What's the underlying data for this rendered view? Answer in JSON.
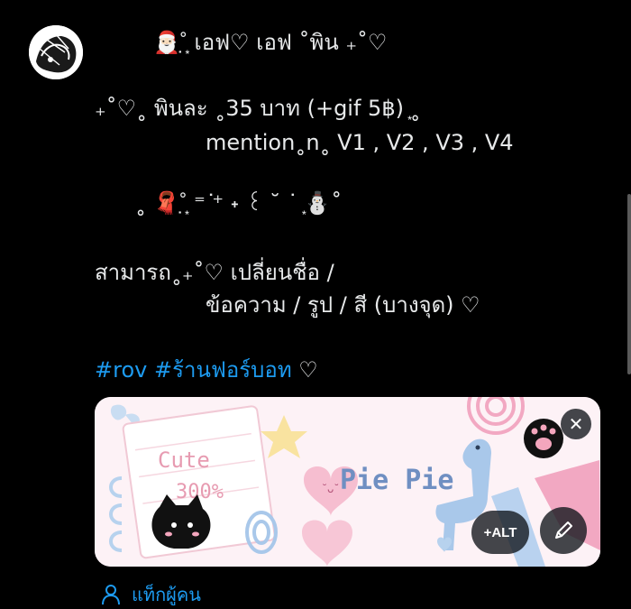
{
  "post": {
    "title_line": "🎅🏻˚̣̣̣͙ เอฟ♡ เอฟ  ˚พิน ₊˚♡",
    "line1": "₊˚♡˳ พินละ ˳35 บาท (+gif 5฿)  ͙˳",
    "line2": "mention˳n˳ V1 , V2 , V3 , V4",
    "line3": "˳  🧣˚̣̣̣͙ ⁼ ͘⁺ ˖ ꒰ ˘ ˙   ͙⛄˚",
    "line4": "สามารถ˳₊˚♡ เปลี่ยนชื่อ /",
    "line5": "ข้อความ / รูป / สี (บางจุด) ♡",
    "hashtag1": "#rov",
    "hashtag2": "#ร้านฟอร์บอท",
    "tags_suffix": " ♡"
  },
  "media": {
    "alt_label": "+ALT",
    "sticker_cute": "Cute",
    "sticker_percent": "300%",
    "sticker_title": "Pie Pie"
  },
  "tag_people_label": "แท็กผู้คน",
  "colors": {
    "accent": "#1d9bf0",
    "background": "#000000",
    "text": "#e7e9ea"
  },
  "icons": {
    "close": "close-icon",
    "edit": "pencil-icon",
    "tag_people": "person-icon"
  }
}
